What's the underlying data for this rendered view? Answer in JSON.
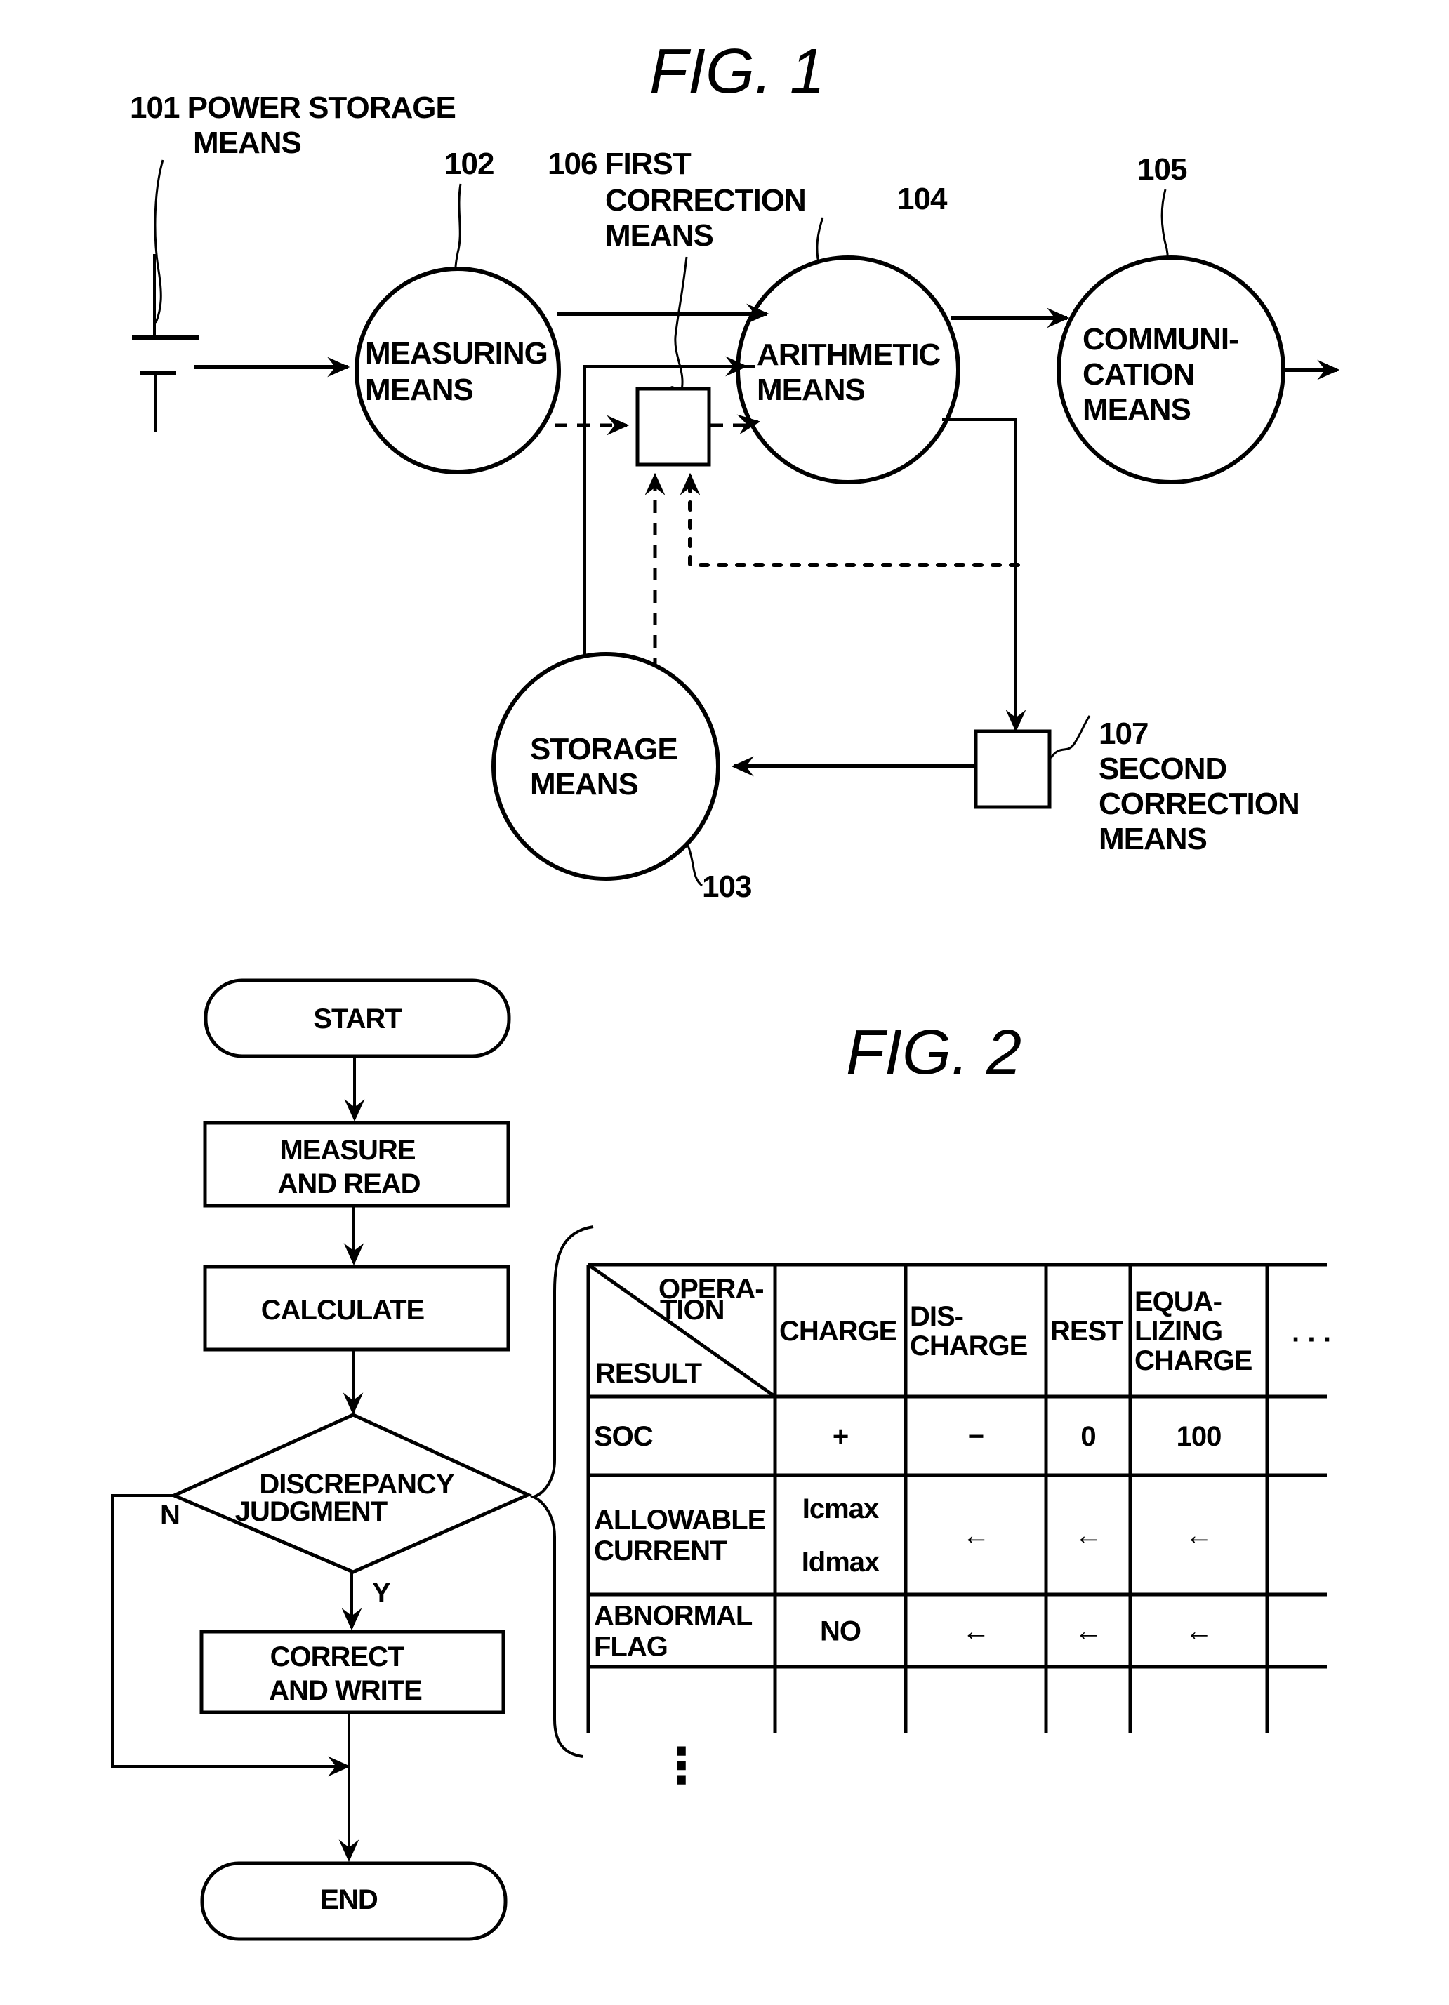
{
  "fig1": {
    "title": "FIG. 1",
    "power_storage": {
      "ref": "101",
      "label_line1": "101 POWER STORAGE",
      "label_line2": "MEANS"
    },
    "measuring": {
      "ref": "102",
      "line1": "MEASURING",
      "line2": "MEANS"
    },
    "storage": {
      "ref": "103",
      "line1": "STORAGE",
      "line2": "MEANS"
    },
    "arithmetic": {
      "ref": "104",
      "line1": "ARITHMETIC",
      "line2": "MEANS"
    },
    "communication": {
      "ref": "105",
      "line1": "COMMUNI-",
      "line2": "CATION",
      "line3": "MEANS"
    },
    "first_correction": {
      "ref_line": "106 FIRST",
      "line2": "CORRECTION",
      "line3": "MEANS"
    },
    "second_correction": {
      "ref": "107",
      "line1": "SECOND",
      "line2": "CORRECTION",
      "line3": "MEANS"
    }
  },
  "fig2": {
    "title": "FIG. 2",
    "flow": {
      "start": "START",
      "measure_line1": "MEASURE",
      "measure_line2": "AND READ",
      "calculate": "CALCULATE",
      "judge_line1": "DISCREPANCY",
      "judge_line2": "JUDGMENT",
      "no_label": "N",
      "yes_label": "Y",
      "correct_line1": "CORRECT",
      "correct_line2": "AND WRITE",
      "end": "END"
    },
    "table": {
      "corner_top_line1": "OPERA-",
      "corner_top_line2": "TION",
      "corner_bottom": "RESULT",
      "columns": [
        {
          "lines": [
            "CHARGE"
          ]
        },
        {
          "lines": [
            "DIS-",
            "CHARGE"
          ]
        },
        {
          "lines": [
            "REST"
          ]
        },
        {
          "lines": [
            "EQUA-",
            "LIZING",
            "CHARGE"
          ]
        }
      ],
      "more_columns": "· · ·",
      "rows": [
        {
          "label": [
            "SOC"
          ],
          "cells": [
            [
              "+"
            ],
            [
              "−"
            ],
            [
              "0"
            ],
            [
              "100"
            ]
          ]
        },
        {
          "label": [
            "ALLOWABLE",
            "CURRENT"
          ],
          "cells": [
            [
              "Icmax",
              "Idmax"
            ],
            [
              "←"
            ],
            [
              "←"
            ],
            [
              "←"
            ]
          ]
        },
        {
          "label": [
            "ABNORMAL",
            "FLAG"
          ],
          "cells": [
            [
              "NO"
            ],
            [
              "←"
            ],
            [
              "←"
            ],
            [
              "←"
            ]
          ]
        }
      ],
      "more_rows": "⋮"
    }
  }
}
